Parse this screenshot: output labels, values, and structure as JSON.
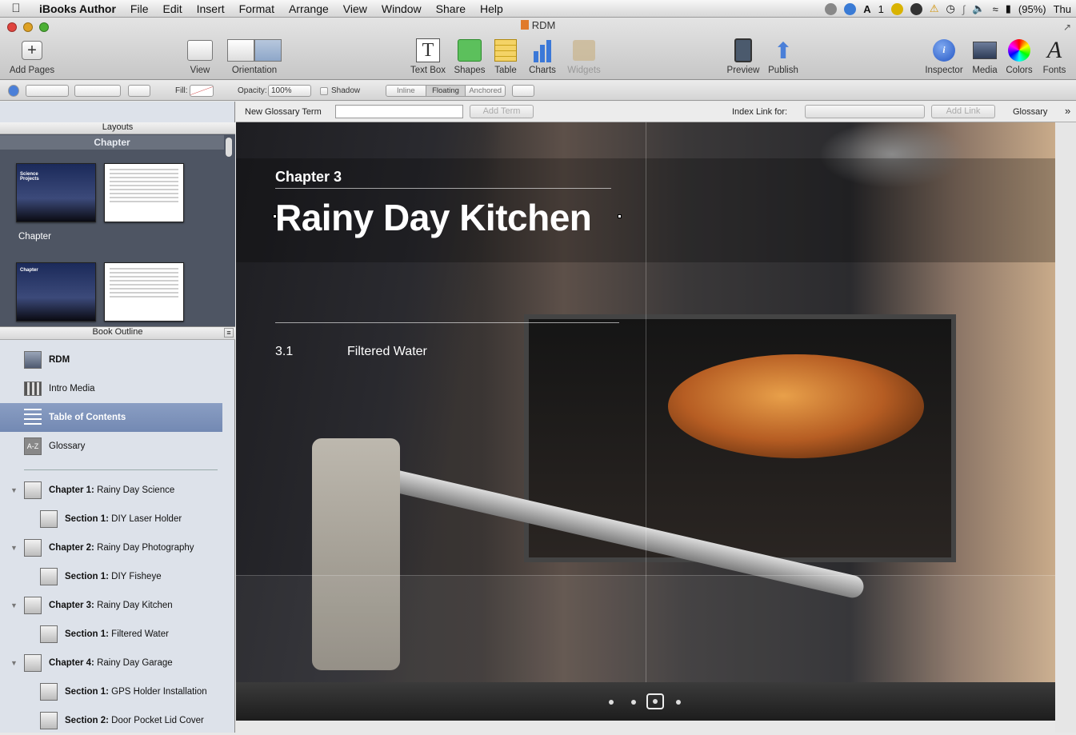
{
  "menubar": {
    "apple": "",
    "items": [
      "iBooks Author",
      "File",
      "Edit",
      "Insert",
      "Format",
      "Arrange",
      "View",
      "Window",
      "Share",
      "Help"
    ],
    "right": {
      "notif_count": "1",
      "battery": "(95%)",
      "clock": "Thu"
    }
  },
  "window": {
    "title": "RDM"
  },
  "toolbar": {
    "add_pages": "Add Pages",
    "view": "View",
    "orientation": "Orientation",
    "text_box": "Text Box",
    "shapes": "Shapes",
    "table": "Table",
    "charts": "Charts",
    "widgets": "Widgets",
    "preview": "Preview",
    "publish": "Publish",
    "inspector": "Inspector",
    "media": "Media",
    "colors": "Colors",
    "fonts": "Fonts"
  },
  "formatbar": {
    "fill_label": "Fill:",
    "opacity_label": "Opacity:",
    "opacity_value": "100%",
    "shadow_label": "Shadow",
    "wrap": [
      "Inline",
      "Floating",
      "Anchored"
    ]
  },
  "glossarybar": {
    "new_term_label": "New Glossary Term",
    "add_term": "Add Term",
    "index_link_label": "Index Link for:",
    "add_link": "Add Link",
    "glossary": "Glossary"
  },
  "sidebar": {
    "layouts_header": "Layouts",
    "chapter_header": "Chapter",
    "thumb_caption": "Chapter",
    "thumb1_text": "Science Projects",
    "thumb2_text": "Chapter",
    "outline_header": "Book Outline",
    "top_items": [
      {
        "label": "RDM"
      },
      {
        "label": "Intro Media"
      },
      {
        "label": "Table of Contents"
      },
      {
        "label": "Glossary"
      }
    ],
    "outline": [
      {
        "kind": "Chapter 1:",
        "title": "Rainy Day Science"
      },
      {
        "kind": "Section 1:",
        "title": "DIY Laser Holder"
      },
      {
        "kind": "Chapter 2:",
        "title": "Rainy Day Photography"
      },
      {
        "kind": "Section 1:",
        "title": "DIY Fisheye"
      },
      {
        "kind": "Chapter 3:",
        "title": "Rainy Day Kitchen"
      },
      {
        "kind": "Section 1:",
        "title": "Filtered Water"
      },
      {
        "kind": "Chapter 4:",
        "title": "Rainy Day Garage"
      },
      {
        "kind": "Section 1:",
        "title": "GPS Holder Installation"
      },
      {
        "kind": "Section 2:",
        "title": "Door Pocket Lid Cover"
      }
    ]
  },
  "page": {
    "chapter_label": "Chapter 3",
    "title": "Rainy Day Kitchen",
    "toc_number": "3.1",
    "toc_text": "Filtered Water",
    "page_dots": 4,
    "current_dot": 3
  }
}
